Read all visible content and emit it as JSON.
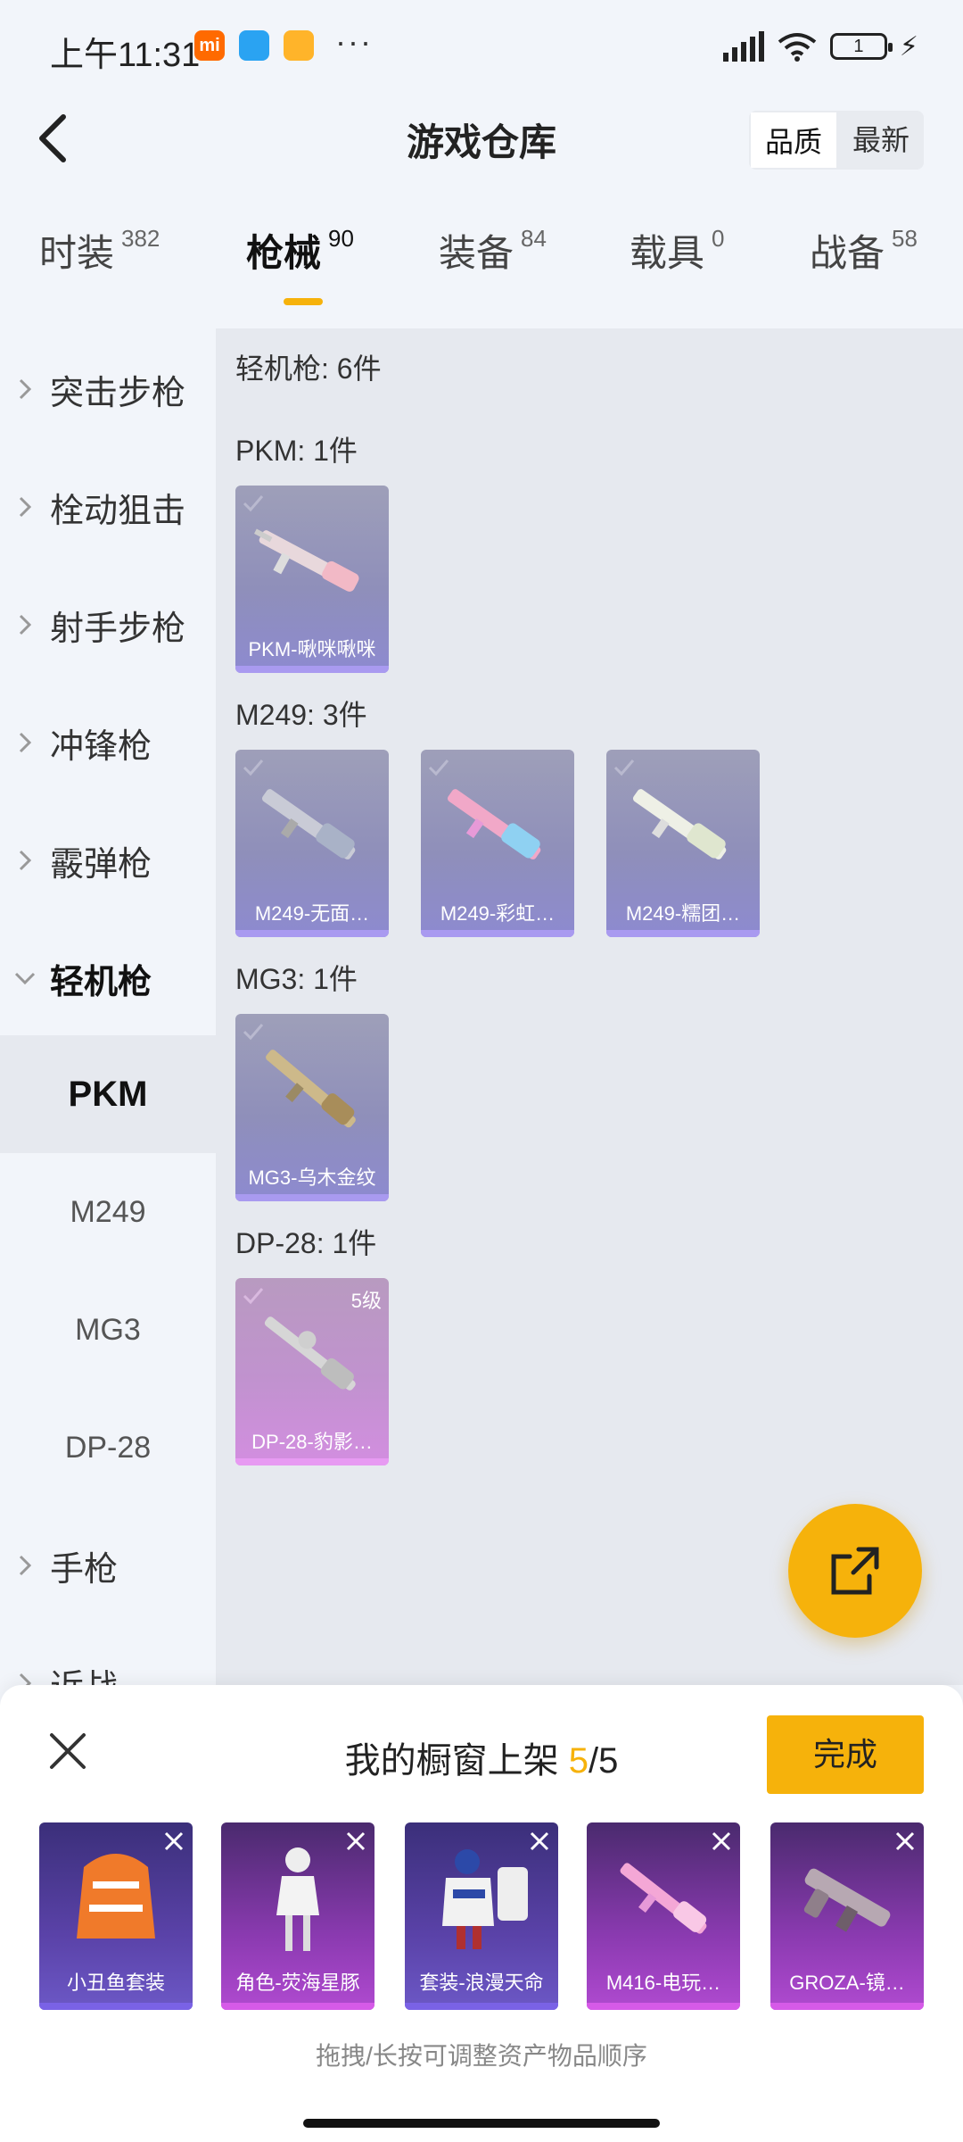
{
  "status": {
    "time": "上午11:31",
    "mi_badge": "mi",
    "battery": "1",
    "dots": "···"
  },
  "header": {
    "title": "游戏仓库",
    "sort_options": [
      "品质",
      "最新"
    ]
  },
  "tabs": [
    {
      "label": "时装",
      "count": "382"
    },
    {
      "label": "枪械",
      "count": "90"
    },
    {
      "label": "装备",
      "count": "84"
    },
    {
      "label": "载具",
      "count": "0"
    },
    {
      "label": "战备",
      "count": "58"
    }
  ],
  "sidebar": {
    "categories": [
      "突击步枪",
      "栓动狙击",
      "射手步枪",
      "冲锋枪",
      "霰弹枪",
      "轻机枪"
    ],
    "sub_items": [
      "PKM",
      "M249",
      "MG3",
      "DP-28"
    ],
    "after": [
      "手枪",
      "近战"
    ]
  },
  "content": {
    "summary": "轻机枪: 6件",
    "sections": [
      {
        "title": "PKM: 1件",
        "items": [
          "PKM-啾咪啾咪"
        ]
      },
      {
        "title": "M249: 3件",
        "items": [
          "M249-无面…",
          "M249-彩虹…",
          "M249-糯团…"
        ]
      },
      {
        "title": "MG3: 1件",
        "items": [
          "MG3-乌木金纹"
        ]
      },
      {
        "title": "DP-28: 1件",
        "items": [
          "DP-28-豹影…"
        ],
        "level": "5级"
      }
    ]
  },
  "sheet": {
    "title": "我的橱窗上架",
    "count": "5",
    "total": "/5",
    "done": "完成",
    "items": [
      "小丑鱼套装",
      "角色-荧海星豚",
      "套装-浪漫天命",
      "M416-电玩…",
      "GROZA-镜…"
    ],
    "hint": "拖拽/长按可调整资产物品顺序"
  },
  "colors": {
    "accent": "#f6b20b",
    "content_bg": "#e6e9ef",
    "card_purple": "#8f8fba",
    "card_pink": "#c192cf"
  }
}
